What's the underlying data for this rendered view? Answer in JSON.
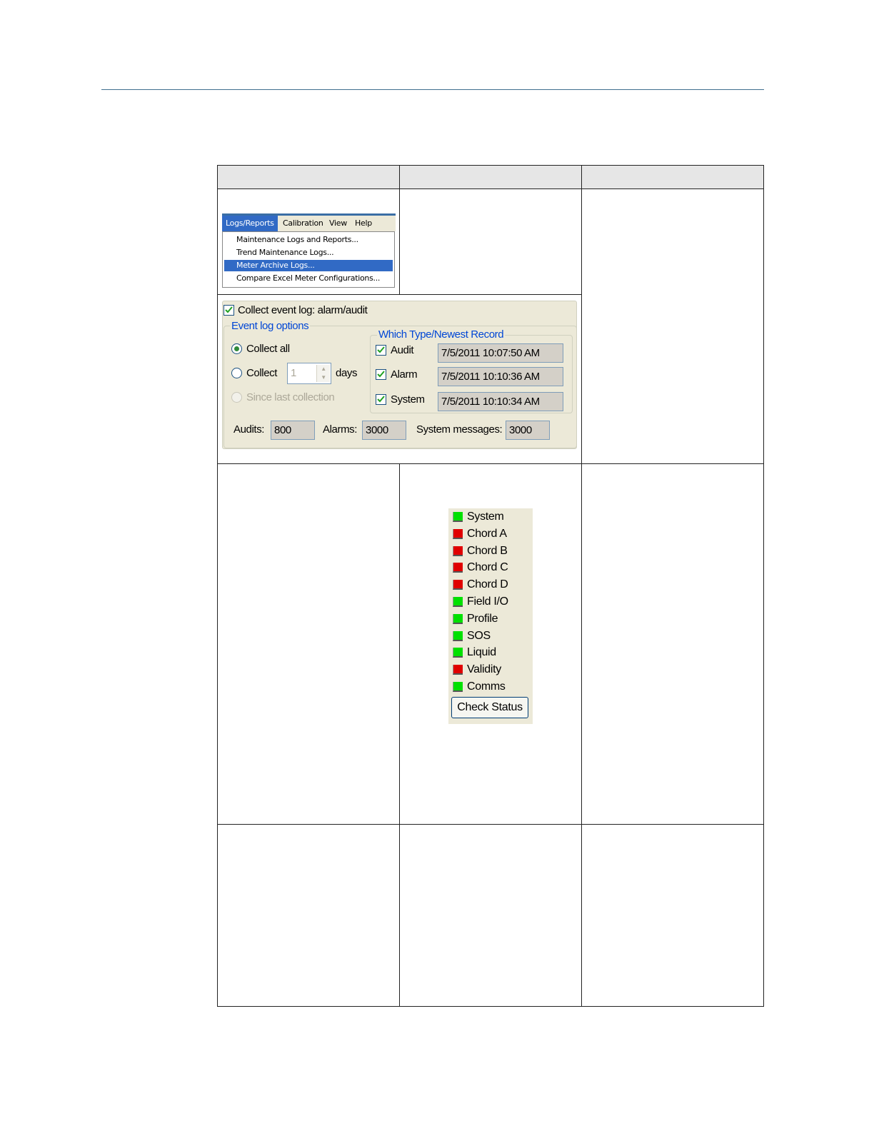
{
  "menu": {
    "bar": [
      "Logs/Reports",
      "Calibration",
      "View",
      "Help"
    ],
    "items": [
      "Maintenance Logs and Reports...",
      "Trend Maintenance Logs...",
      "Meter Archive Logs...",
      "Compare Excel Meter Configurations..."
    ],
    "selected_index": 2
  },
  "event_log": {
    "collect_label": "Collect event log: alarm/audit",
    "collect_checked": true,
    "options_legend": "Event log options",
    "collect_all": "Collect all",
    "collect": "Collect",
    "days_value": "1",
    "days": "days",
    "since_last": "Since last collection",
    "types_legend": "Which Type/Newest Record",
    "types": [
      {
        "label": "Audit",
        "checked": true,
        "record": "7/5/2011 10:07:50 AM"
      },
      {
        "label": "Alarm",
        "checked": true,
        "record": "7/5/2011 10:10:36 AM"
      },
      {
        "label": "System",
        "checked": true,
        "record": "7/5/2011 10:10:34 AM"
      }
    ],
    "audits_label": "Audits:",
    "audits_value": "800",
    "alarms_label": "Alarms:",
    "alarms_value": "3000",
    "sysmsg_label": "System messages:",
    "sysmsg_value": "3000"
  },
  "status": {
    "items": [
      {
        "label": "System",
        "state": "green"
      },
      {
        "label": "Chord A",
        "state": "red"
      },
      {
        "label": "Chord B",
        "state": "red"
      },
      {
        "label": "Chord C",
        "state": "red"
      },
      {
        "label": "Chord D",
        "state": "red"
      },
      {
        "label": "Field I/O",
        "state": "green"
      },
      {
        "label": "Profile",
        "state": "green"
      },
      {
        "label": "SOS",
        "state": "green"
      },
      {
        "label": "Liquid",
        "state": "green"
      },
      {
        "label": "Validity",
        "state": "red"
      },
      {
        "label": "Comms",
        "state": "green"
      }
    ],
    "button": "Check Status",
    "colors": {
      "green": "#00e000",
      "red": "#e00000"
    }
  }
}
